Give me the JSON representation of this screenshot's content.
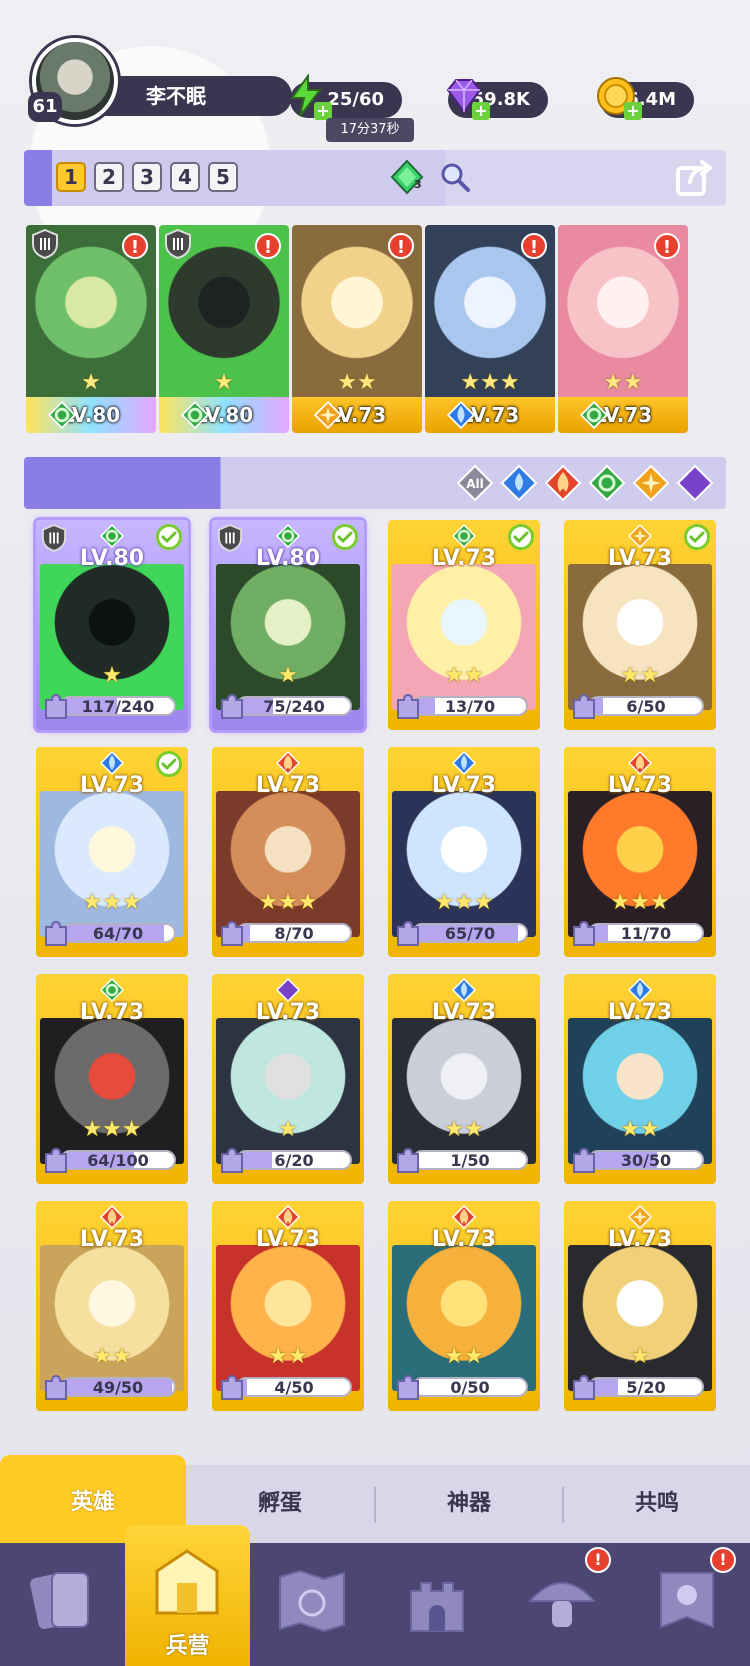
{
  "player": {
    "level": "61",
    "name": "李不眠"
  },
  "resources": {
    "energy": {
      "value": "25/60",
      "timer": "17分37秒",
      "icon": "lightning-icon"
    },
    "gems": {
      "value": "59.8K",
      "icon": "purple-gem-icon"
    },
    "gold": {
      "value": "6.4M",
      "icon": "gold-coin-icon"
    }
  },
  "team_bar": {
    "tabs": [
      "1",
      "2",
      "3",
      "4",
      "5"
    ],
    "active_tab": 0,
    "gem_count": "3"
  },
  "team": [
    {
      "level": "LV.80",
      "element": "nature",
      "stars": "★",
      "frame": "rainbow",
      "rank": "III",
      "alert": "!"
    },
    {
      "level": "LV.80",
      "element": "nature",
      "stars": "★",
      "frame": "rainbow",
      "rank": "III",
      "alert": "!"
    },
    {
      "level": "LV.73",
      "element": "light",
      "stars": "★★",
      "frame": "gold",
      "alert": "!"
    },
    {
      "level": "LV.73",
      "element": "water",
      "stars": "★★★",
      "frame": "gold",
      "alert": "!"
    },
    {
      "level": "LV.73",
      "element": "nature",
      "stars": "★★",
      "frame": "gold",
      "alert": "!"
    }
  ],
  "filters": {
    "all_label": "All",
    "elements": [
      "water",
      "fire",
      "nature",
      "light",
      "dark"
    ]
  },
  "heroes": [
    {
      "level": "LV.80",
      "element": "nature",
      "fragments": "117/240",
      "progress": 0.49,
      "stars": "★",
      "selected": true,
      "checked": true,
      "rank": true
    },
    {
      "level": "LV.80",
      "element": "nature",
      "fragments": "75/240",
      "progress": 0.31,
      "stars": "★",
      "selected": true,
      "checked": true,
      "rank": true
    },
    {
      "level": "LV.73",
      "element": "nature",
      "fragments": "13/70",
      "progress": 0.19,
      "stars": "★★",
      "checked": true
    },
    {
      "level": "LV.73",
      "element": "light",
      "fragments": "6/50",
      "progress": 0.12,
      "stars": "★★",
      "checked": true
    },
    {
      "level": "LV.73",
      "element": "water",
      "fragments": "64/70",
      "progress": 0.91,
      "stars": "★★★",
      "checked": true
    },
    {
      "level": "LV.73",
      "element": "fire",
      "fragments": "8/70",
      "progress": 0.11,
      "stars": "★★★"
    },
    {
      "level": "LV.73",
      "element": "water",
      "fragments": "65/70",
      "progress": 0.93,
      "stars": "★★★"
    },
    {
      "level": "LV.73",
      "element": "fire",
      "fragments": "11/70",
      "progress": 0.16,
      "stars": "★★★"
    },
    {
      "level": "LV.73",
      "element": "nature",
      "fragments": "64/100",
      "progress": 0.64,
      "stars": "★★★"
    },
    {
      "level": "LV.73",
      "element": "dark",
      "fragments": "6/20",
      "progress": 0.3,
      "stars": "★"
    },
    {
      "level": "LV.73",
      "element": "water",
      "fragments": "1/50",
      "progress": 0.02,
      "stars": "★★"
    },
    {
      "level": "LV.73",
      "element": "water",
      "fragments": "30/50",
      "progress": 0.6,
      "stars": "★★"
    },
    {
      "level": "LV.73",
      "element": "fire",
      "fragments": "49/50",
      "progress": 0.98,
      "stars": "★★"
    },
    {
      "level": "LV.73",
      "element": "fire",
      "fragments": "4/50",
      "progress": 0.08,
      "stars": "★★"
    },
    {
      "level": "LV.73",
      "element": "fire",
      "fragments": "0/50",
      "progress": 0,
      "stars": "★★"
    },
    {
      "level": "LV.73",
      "element": "light",
      "fragments": "5/20",
      "progress": 0.25,
      "stars": "★"
    }
  ],
  "sub_tabs": [
    "英雄",
    "孵蛋",
    "神器",
    "共鸣"
  ],
  "bottom_nav": [
    {
      "icon": "cards-icon",
      "label": ""
    },
    {
      "icon": "barracks-icon",
      "label": "兵营",
      "active": true
    },
    {
      "icon": "map-icon",
      "label": ""
    },
    {
      "icon": "castle-icon",
      "label": ""
    },
    {
      "icon": "mushroom-icon",
      "label": "",
      "alert": "!"
    },
    {
      "icon": "banner-icon",
      "label": "",
      "alert": "!"
    }
  ],
  "colors": {
    "water": "#2f7be3",
    "fire": "#e2452b",
    "nature": "#35a846",
    "light": "#f0a21c",
    "dark": "#7a41c9",
    "gold_frame": "#f3b80c",
    "selected_frame": "#9c86ef"
  }
}
